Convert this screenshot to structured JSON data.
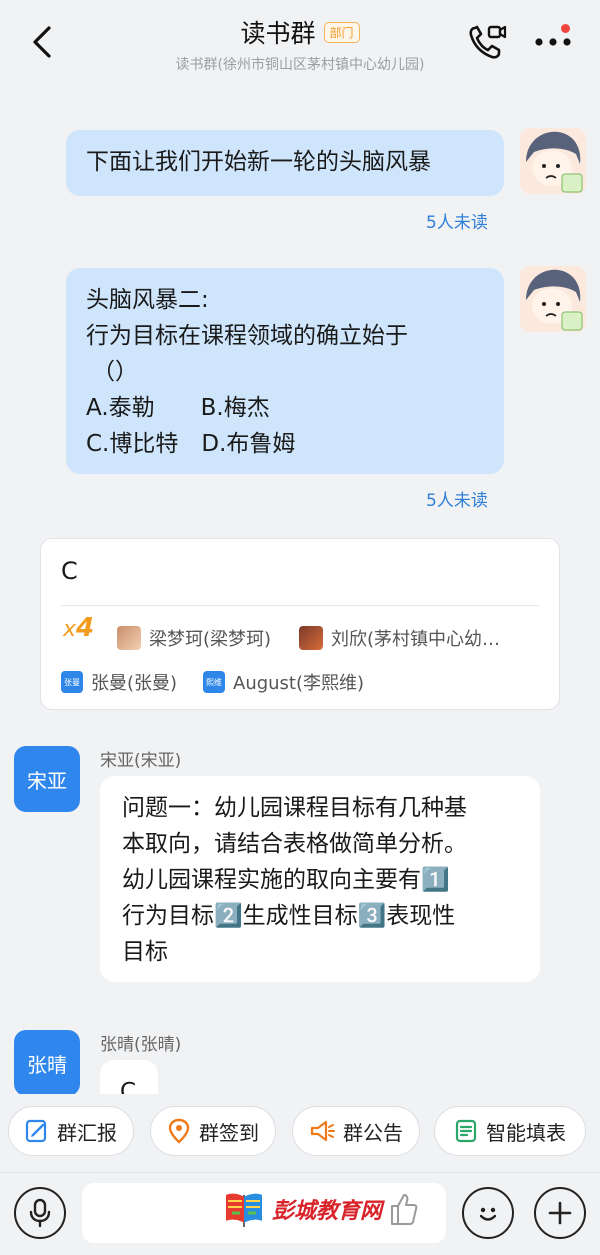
{
  "header": {
    "title": "读书群",
    "badge": "部门",
    "subtitle": "读书群(徐州市铜山区茅村镇中心幼儿园)"
  },
  "messages": {
    "self_1": {
      "text": "下面让我们开始新一轮的头脑风暴",
      "unread": "5人未读"
    },
    "self_2": {
      "lines": [
        "头脑风暴二:",
        "行为目标在课程领域的确立始于",
        "（）",
        "A.泰勒　　B.梅杰",
        "C.博比特　D.布鲁姆"
      ],
      "unread": "5人未读"
    },
    "answer_card": {
      "answer": "C",
      "count_prefix": "x",
      "count": "4",
      "members": [
        {
          "name": "梁梦珂(梁梦珂)"
        },
        {
          "name": "刘欣(茅村镇中心幼…"
        },
        {
          "name": "张曼(张曼)",
          "tag": "张曼"
        },
        {
          "name": "August(李熙维)",
          "tag": "熙维"
        }
      ]
    },
    "song_ya": {
      "avatar": "宋亚",
      "sender": "宋亚(宋亚)",
      "lines": [
        "问题一：幼儿园课程目标有几种基",
        "本取向，请结合表格做简单分析。",
        "幼儿园课程实施的取向主要有1️⃣",
        "行为目标2️⃣生成性目标3️⃣表现性",
        "目标"
      ]
    },
    "zhang_qing": {
      "avatar": "张晴",
      "sender": "张晴(张晴)",
      "text": "C"
    }
  },
  "quick_actions": [
    {
      "label": "群汇报",
      "icon": "report-icon"
    },
    {
      "label": "群签到",
      "icon": "location-icon"
    },
    {
      "label": "群公告",
      "icon": "megaphone-icon"
    },
    {
      "label": "智能填表",
      "icon": "form-icon"
    }
  ],
  "watermark": "彭城教育网",
  "colors": {
    "accent": "#2f87ee",
    "self_bubble": "#cfe5fb",
    "unread": "#2f7fd8",
    "count": "#f29b1e",
    "badge": "#f19a23"
  }
}
